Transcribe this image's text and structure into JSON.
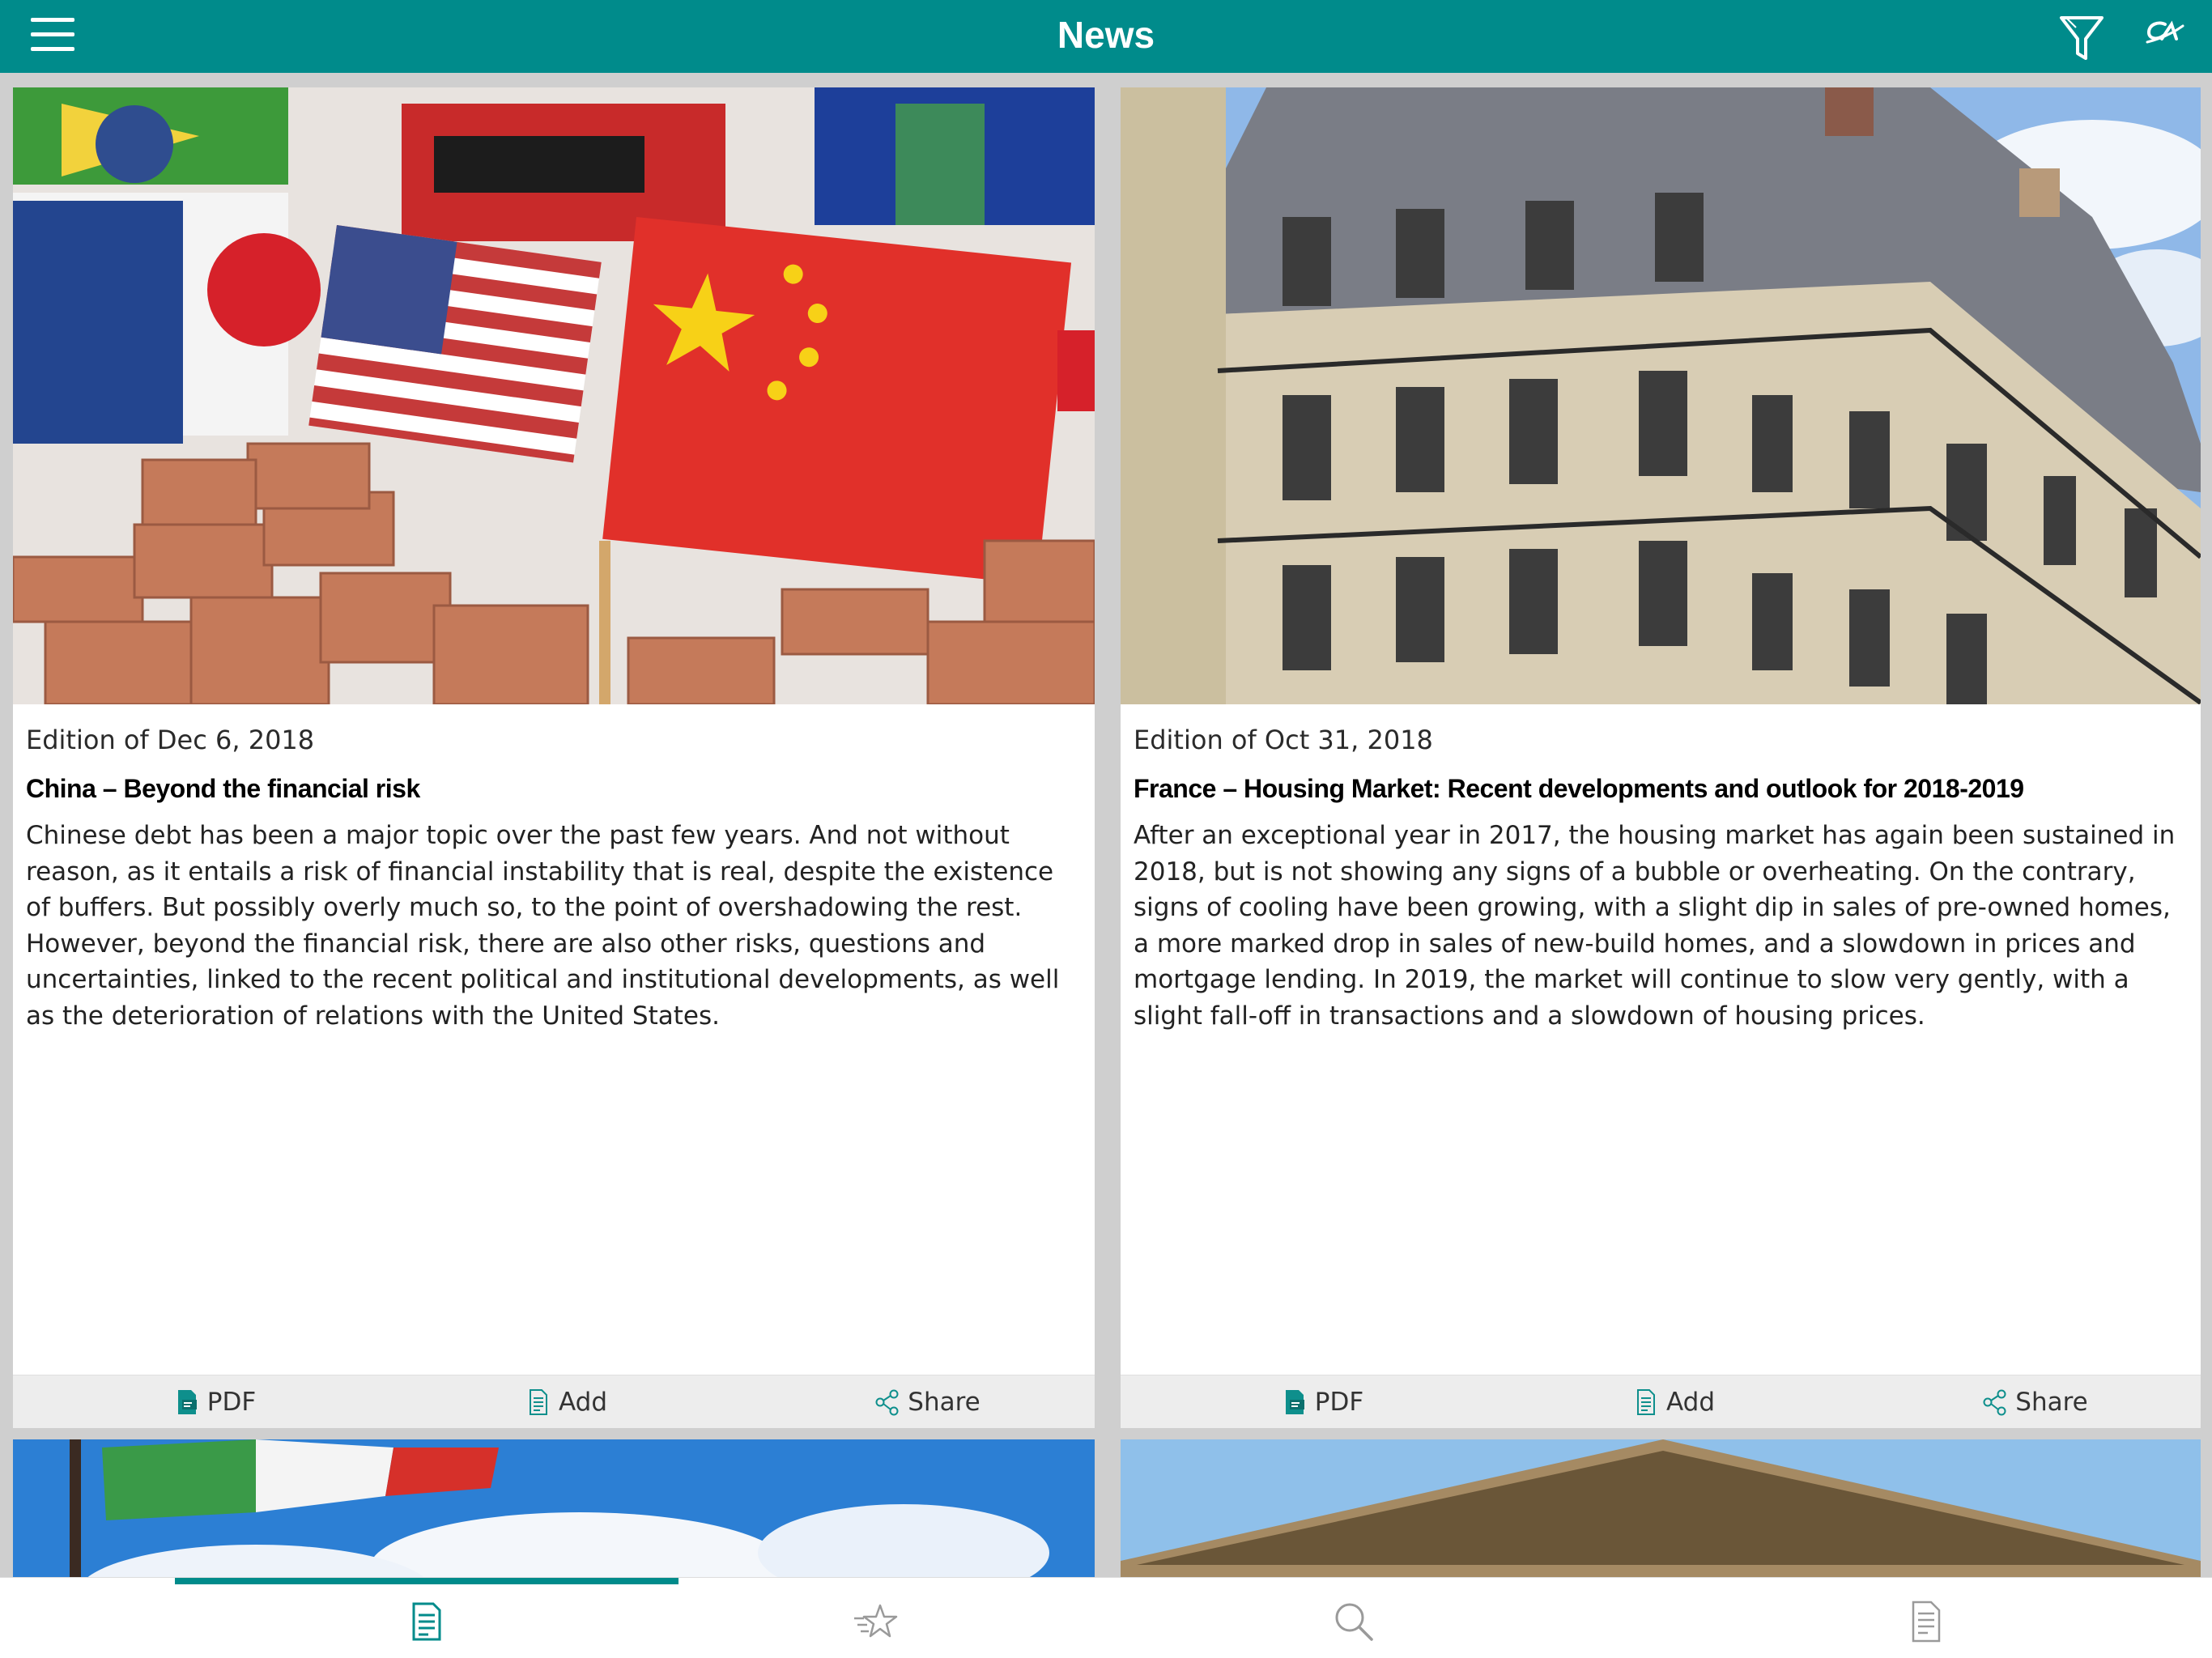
{
  "header": {
    "title": "News",
    "menu_icon": "hamburger-icon",
    "filter_icon": "filter-icon",
    "logo_text": "CA"
  },
  "colors": {
    "accent": "#008b8b",
    "card_background": "#ffffff",
    "page_background": "#cfcfcf",
    "actions_background": "#ededed"
  },
  "articles": [
    {
      "edition": "Edition of Dec 6, 2018",
      "title": "China – Beyond the financial risk",
      "summary": "Chinese debt has been a major topic over the past few years. And not without reason, as it entails a risk of financial instability that is real, despite the existence of buffers. But possibly overly much so, to the point of overshadowing the rest. However, beyond the financial risk, there are also other risks, questions and uncertainties, linked to the recent political and institutional developments, as well as the deterioration of relations with the United States.",
      "actions": {
        "pdf": "PDF",
        "add": "Add",
        "share": "Share"
      }
    },
    {
      "edition": "Edition of Oct 31, 2018",
      "title": "France – Housing Market: Recent developments and outlook for 2018-2019",
      "summary": "After an exceptional year in 2017, the housing market has again been sustained in 2018, but is not showing any signs of a bubble or overheating. On the contrary, signs of cooling have been growing, with a slight dip in sales of pre-owned homes, a more marked drop in sales of new-build homes, and a slowdown in prices and mortgage lending. In 2019, the market will continue to slow very gently, with a slight fall-off in transactions and a slowdown of housing prices.",
      "actions": {
        "pdf": "PDF",
        "add": "Add",
        "share": "Share"
      }
    }
  ],
  "tabs": [
    {
      "icon": "news-document-icon",
      "active": true
    },
    {
      "icon": "favorites-star-icon",
      "active": false
    },
    {
      "icon": "search-icon",
      "active": false
    },
    {
      "icon": "saved-documents-icon",
      "active": false
    }
  ]
}
